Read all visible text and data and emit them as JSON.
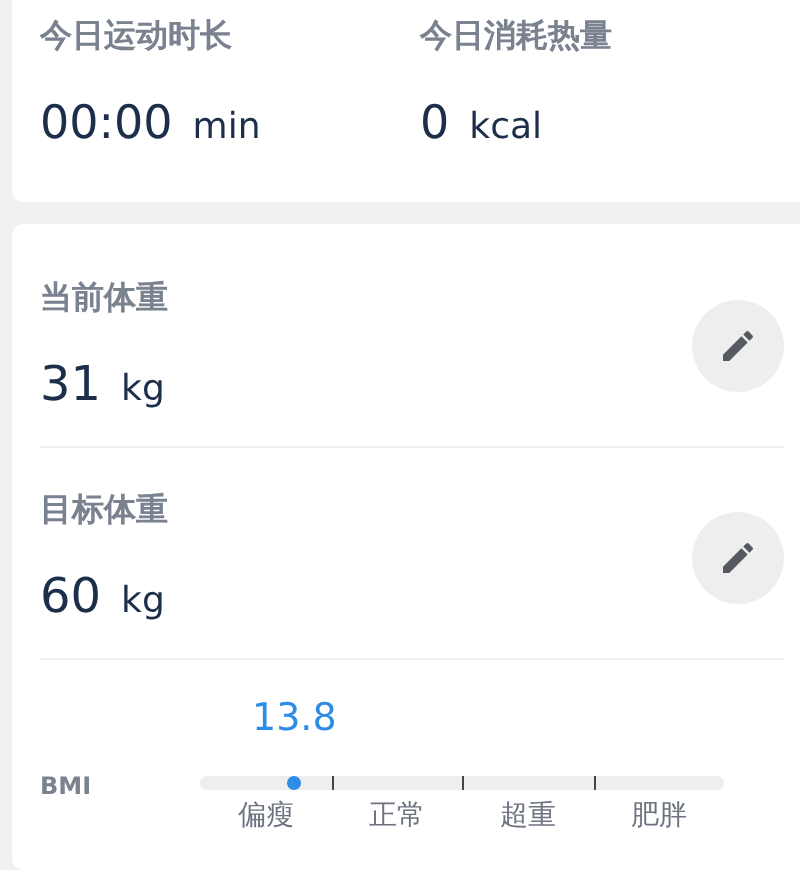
{
  "today_stats": [
    {
      "label": "今日运动时长",
      "value": "00:00",
      "unit": "min"
    },
    {
      "label": "今日消耗热量",
      "value": "0",
      "unit": "kcal"
    }
  ],
  "weights": [
    {
      "label": "当前体重",
      "value": "31",
      "unit": "kg"
    },
    {
      "label": "目标体重",
      "value": "60",
      "unit": "kg"
    }
  ],
  "bmi": {
    "label": "BMI",
    "value": "13.8",
    "level": 0.18,
    "categories": [
      "偏瘦",
      "正常",
      "超重",
      "肥胖"
    ]
  }
}
